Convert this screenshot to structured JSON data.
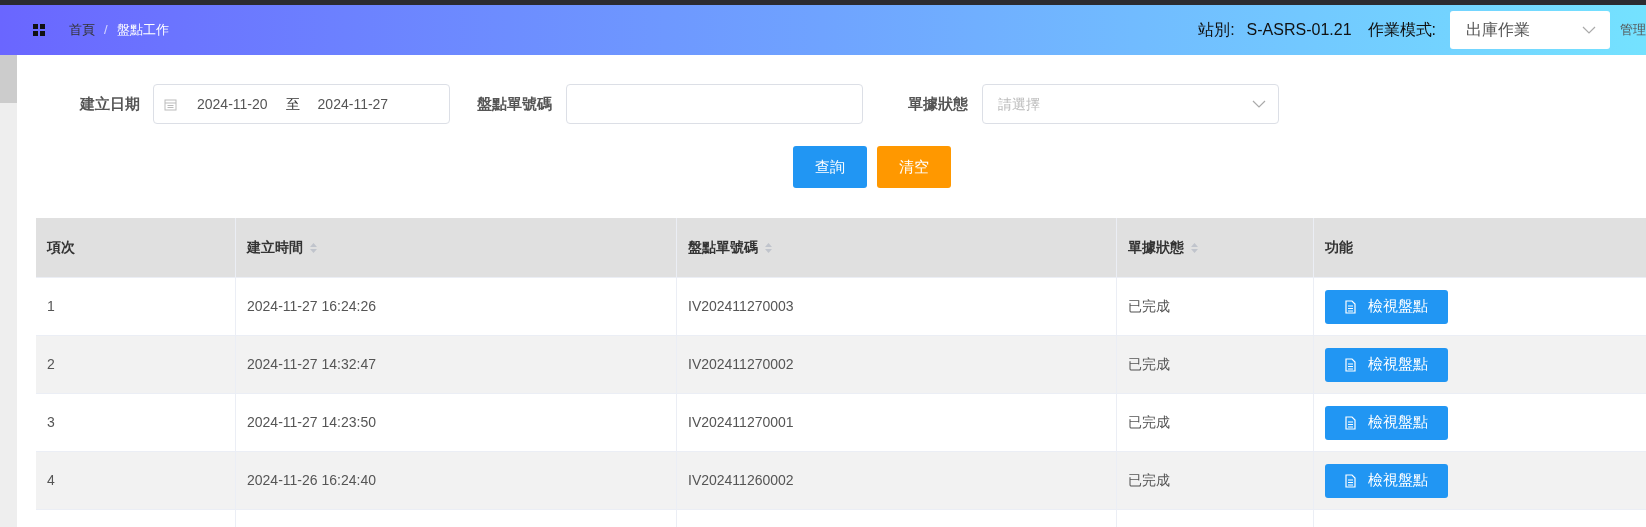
{
  "header": {
    "breadcrumb": [
      "首頁",
      "盤點工作"
    ],
    "breadcrumb_separator": "/",
    "station_label": "站別:",
    "station": "S-ASRS-01.21",
    "mode_label": "作業模式:",
    "mode": "出庫作業",
    "user_menu": "管理"
  },
  "filters": {
    "date_label": "建立日期",
    "date_from": "2024-11-20",
    "date_sep": "至",
    "date_to": "2024-11-27",
    "code_label": "盤點單號碼",
    "status_label": "單據狀態",
    "status_placeholder": "請選擇"
  },
  "buttons": [
    {
      "label": "查詢",
      "kind": "primary"
    },
    {
      "label": "清空",
      "kind": "warning"
    }
  ],
  "table": {
    "columns": [
      {
        "label": "項次",
        "sortable": false
      },
      {
        "label": "建立時間",
        "sortable": true
      },
      {
        "label": "盤點單號碼",
        "sortable": true
      },
      {
        "label": "單據狀態",
        "sortable": true
      },
      {
        "label": "功能",
        "sortable": false
      }
    ],
    "rows": [
      {
        "index": "1",
        "created": "2024-11-27 16:24:26",
        "code": "IV202411270003",
        "status": "已完成",
        "action": "檢視盤點"
      },
      {
        "index": "2",
        "created": "2024-11-27 14:32:47",
        "code": "IV202411270002",
        "status": "已完成",
        "action": "檢視盤點"
      },
      {
        "index": "3",
        "created": "2024-11-27 14:23:50",
        "code": "IV202411270001",
        "status": "已完成",
        "action": "檢視盤點"
      },
      {
        "index": "4",
        "created": "2024-11-26 16:24:40",
        "code": "IV202411260002",
        "status": "已完成",
        "action": "檢視盤點"
      }
    ]
  }
}
